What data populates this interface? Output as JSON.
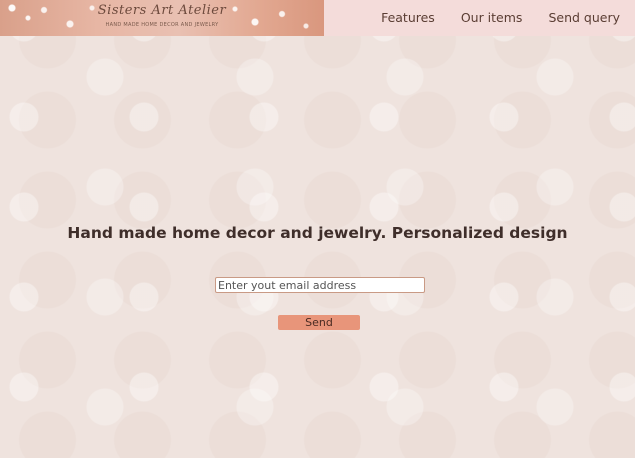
{
  "header": {
    "logo_title": "Sisters Art Atelier",
    "logo_tagline": "HAND MADE HOME DECOR AND JEWELRY",
    "nav": [
      {
        "label": "Features"
      },
      {
        "label": "Our items"
      },
      {
        "label": "Send query"
      }
    ]
  },
  "hero": {
    "heading": "Hand made home decor and jewelry. Personalized design"
  },
  "form": {
    "email_placeholder": "Enter yout email address",
    "email_value": "",
    "submit_label": "Send"
  },
  "colors": {
    "header_bg": "#f4dcda",
    "page_bg": "#efe3de",
    "button_bg": "#e8957a",
    "text_dark": "#3f2e2a"
  },
  "icons": {
    "logo": "pearl-banner-logo"
  }
}
